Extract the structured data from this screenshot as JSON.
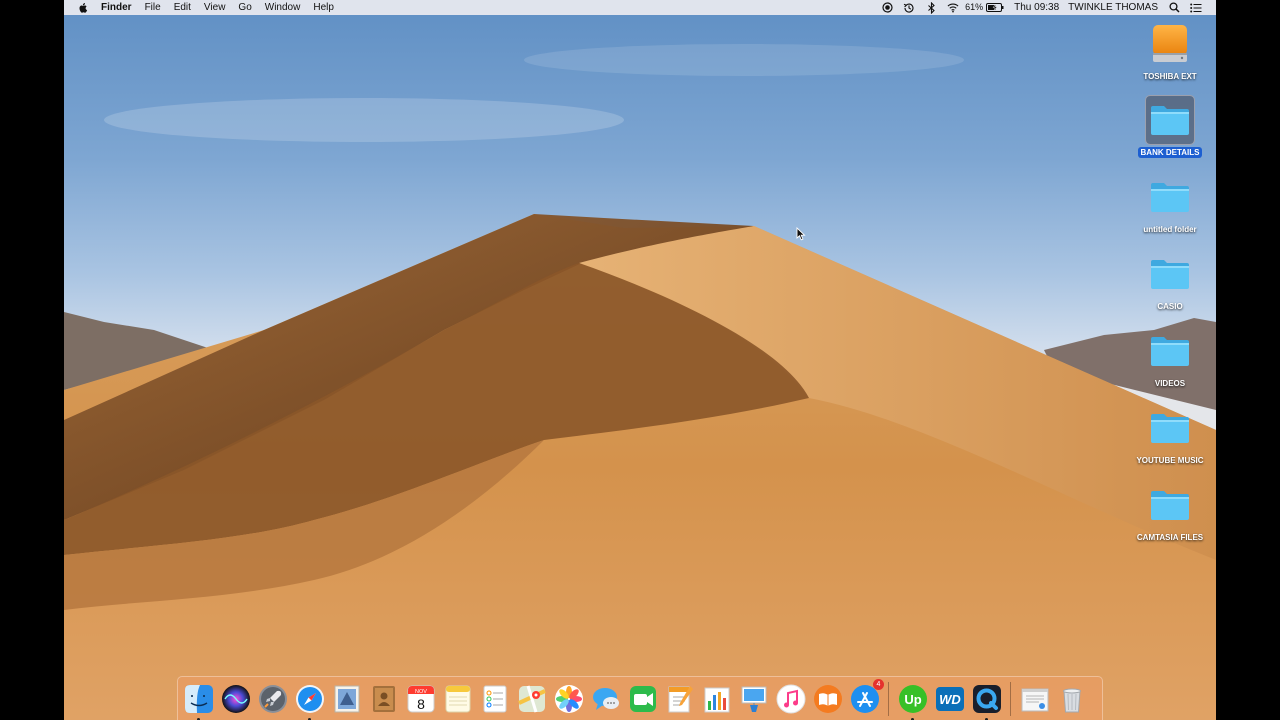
{
  "menubar": {
    "apple_icon": "apple-icon",
    "app_name": "Finder",
    "menus": [
      "File",
      "Edit",
      "View",
      "Go",
      "Window",
      "Help"
    ],
    "status_icons": [
      "record-icon",
      "time-machine-icon",
      "bluetooth-icon",
      "wifi-icon"
    ],
    "battery_percent": "61%",
    "battery_icon": "battery-icon",
    "clock": "Thu 09:38",
    "user": "TWINKLE THOMAS",
    "search_icon": "spotlight-search-icon",
    "notifications_icon": "notification-center-icon"
  },
  "desktop_icons": [
    {
      "label": "TOSHIBA EXT",
      "kind": "external-drive-icon",
      "selected": false
    },
    {
      "label": "BANK DETAILS",
      "kind": "folder-icon",
      "selected": true
    },
    {
      "label": "untitled folder",
      "kind": "folder-icon",
      "selected": false
    },
    {
      "label": "CASIO",
      "kind": "folder-icon",
      "selected": false
    },
    {
      "label": "VIDEOS",
      "kind": "folder-icon",
      "selected": false
    },
    {
      "label": "YOUTUBE MUSIC",
      "kind": "folder-icon",
      "selected": false
    },
    {
      "label": "CAMTASIA FILES",
      "kind": "folder-icon",
      "selected": false
    }
  ],
  "dock": {
    "apps": [
      {
        "name": "finder",
        "icon": "finder-icon",
        "running": true
      },
      {
        "name": "siri",
        "icon": "siri-icon",
        "running": false
      },
      {
        "name": "launchpad",
        "icon": "launchpad-rocket-icon",
        "running": false
      },
      {
        "name": "safari",
        "icon": "safari-compass-icon",
        "running": true
      },
      {
        "name": "mail",
        "icon": "mail-stamp-icon",
        "running": false
      },
      {
        "name": "contacts",
        "icon": "contacts-book-icon",
        "running": false
      },
      {
        "name": "calendar",
        "icon": "calendar-icon",
        "running": false,
        "month": "NOV",
        "day": "8"
      },
      {
        "name": "notes",
        "icon": "notes-icon",
        "running": false
      },
      {
        "name": "reminders",
        "icon": "reminders-icon",
        "running": false
      },
      {
        "name": "maps",
        "icon": "maps-icon",
        "running": false
      },
      {
        "name": "photos",
        "icon": "photos-flower-icon",
        "running": false
      },
      {
        "name": "messages",
        "icon": "messages-bubble-icon",
        "running": false
      },
      {
        "name": "facetime",
        "icon": "facetime-camera-icon",
        "running": false
      },
      {
        "name": "pages",
        "icon": "pages-icon",
        "running": false
      },
      {
        "name": "numbers",
        "icon": "numbers-chart-icon",
        "running": false
      },
      {
        "name": "keynote",
        "icon": "keynote-podium-icon",
        "running": false
      },
      {
        "name": "itunes",
        "icon": "itunes-music-icon",
        "running": false
      },
      {
        "name": "ibooks",
        "icon": "ibooks-icon",
        "running": false
      },
      {
        "name": "app-store",
        "icon": "app-store-icon",
        "running": false,
        "badge": "4"
      },
      {
        "name": "upwork",
        "icon": "upwork-icon",
        "running": true,
        "text": "Up"
      },
      {
        "name": "wd",
        "icon": "wd-icon",
        "running": false,
        "text": "WD"
      },
      {
        "name": "quicktime",
        "icon": "quicktime-icon",
        "running": true
      },
      {
        "name": "preview",
        "icon": "preview-document-icon",
        "running": false
      },
      {
        "name": "trash",
        "icon": "trash-icon",
        "running": false
      }
    ]
  },
  "colors": {
    "folder_blue": "#5cc6f5",
    "selection_blue": "#1d5fd1",
    "sand": "#d39550",
    "sky_top": "#5f8fc4"
  }
}
